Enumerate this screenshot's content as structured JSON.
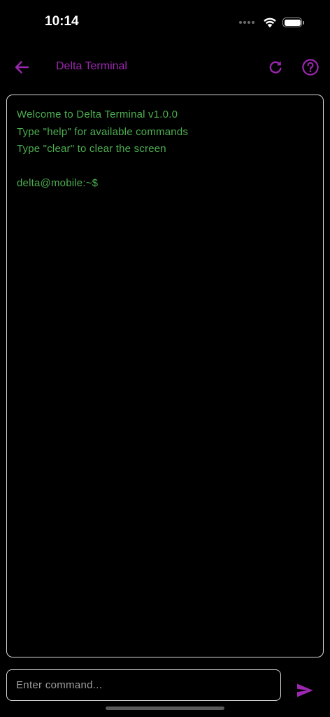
{
  "status_bar": {
    "time": "10:14",
    "battery_level": 1.0
  },
  "app_bar": {
    "title": "Delta Terminal"
  },
  "terminal": {
    "lines": [
      "Welcome to Delta Terminal v1.0.0",
      "Type \"help\" for available commands",
      "Type \"clear\" to clear the screen",
      "",
      "delta@mobile:~$"
    ]
  },
  "command_input": {
    "value": "",
    "placeholder": "Enter command..."
  },
  "colors": {
    "accent": "#9c27b0",
    "terminal_text": "#4caf50",
    "border": "#d8d8d8",
    "background": "#000000"
  },
  "icons": {
    "back": "arrow-back-icon",
    "refresh": "refresh-icon",
    "help": "help-icon",
    "send": "send-icon",
    "wifi": "wifi-icon",
    "battery": "battery-icon",
    "signal": "signal-icon"
  }
}
